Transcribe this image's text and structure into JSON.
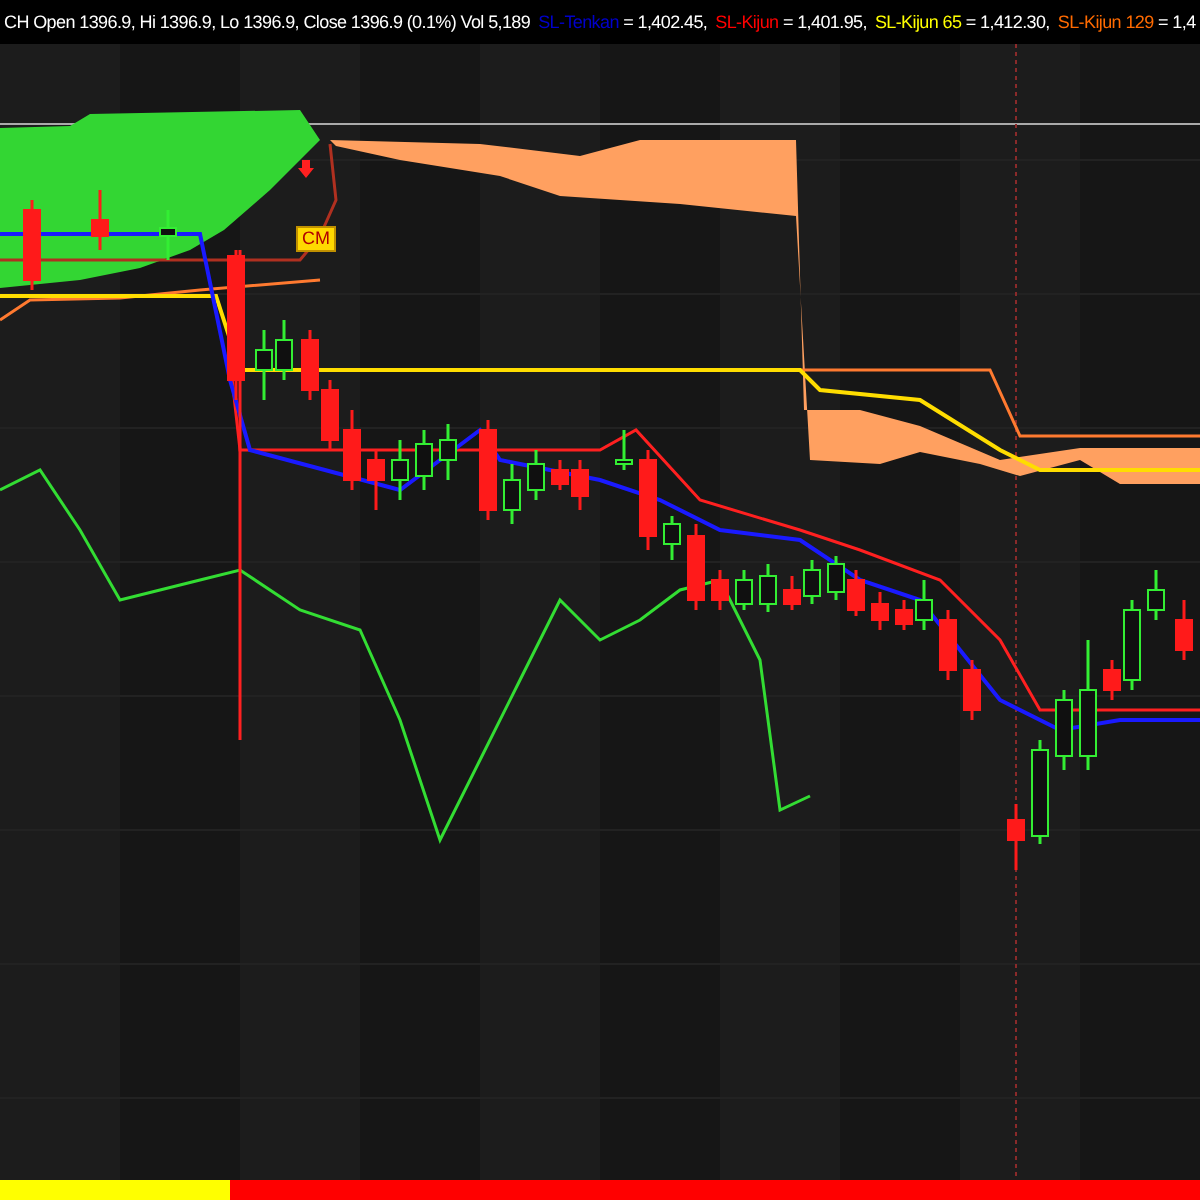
{
  "header": {
    "quote": "CH Open 1396.9, Hi 1396.9, Lo 1396.9, Close 1396.9 (0.1%) Vol 5,189",
    "legend": [
      {
        "label": "SL-Tenkan",
        "value": " = 1,402.45,",
        "color": "#0000cc"
      },
      {
        "label": "SL-Kijun",
        "value": " = 1,401.95,",
        "color": "#ff0000"
      },
      {
        "label": "SL-Kijun 65",
        "value": " = 1,412.30,",
        "color": "#ffff00"
      },
      {
        "label": "SL-Kijun 129",
        "value": " = 1,4",
        "color": "#ff6a00"
      }
    ]
  },
  "chart": {
    "marker": "CM"
  },
  "status_strip": [
    {
      "color": "#ffff00"
    },
    {
      "color": "#ff0000"
    }
  ]
}
